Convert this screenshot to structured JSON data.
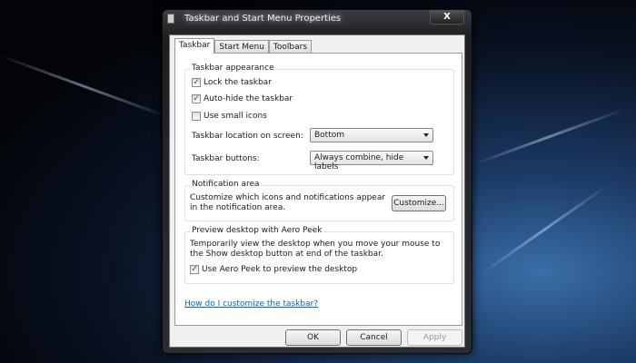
{
  "window": {
    "title": "Taskbar and Start Menu Properties",
    "close_label": "X"
  },
  "tabs": [
    {
      "label": "Taskbar"
    },
    {
      "label": "Start Menu"
    },
    {
      "label": "Toolbars"
    }
  ],
  "appearance": {
    "title": "Taskbar appearance",
    "lock": {
      "label": "Lock the taskbar",
      "checked": true
    },
    "autohide": {
      "label": "Auto-hide the taskbar",
      "checked": true
    },
    "small_icons": {
      "label": "Use small icons",
      "checked": false
    },
    "location_label": "Taskbar location on screen:",
    "location_value": "Bottom",
    "buttons_label": "Taskbar buttons:",
    "buttons_value": "Always combine, hide labels"
  },
  "notification": {
    "title": "Notification area",
    "text": "Customize which icons and notifications appear in the notification area.",
    "customize_label": "Customize..."
  },
  "peek": {
    "title": "Preview desktop with Aero Peek",
    "text": "Temporarily view the desktop when you move your mouse to the Show desktop button at end of the taskbar.",
    "checkbox": {
      "label": "Use Aero Peek to preview the desktop",
      "checked": true
    }
  },
  "help_link": "How do I customize the taskbar?",
  "buttons": {
    "ok": "OK",
    "cancel": "Cancel",
    "apply": "Apply"
  }
}
